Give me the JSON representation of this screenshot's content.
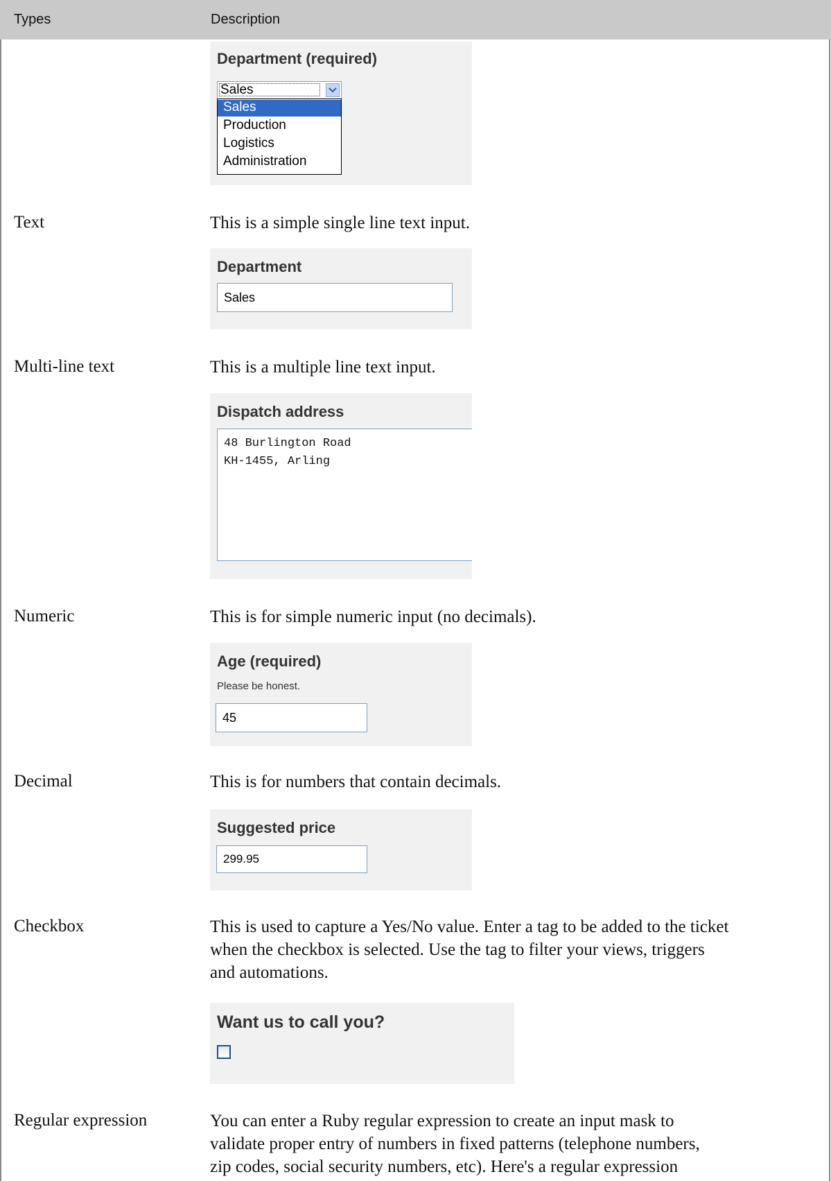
{
  "header": {
    "col_types": "Types",
    "col_description": "Description"
  },
  "rows": {
    "dropdown": {
      "panel": {
        "label": "Department (required)",
        "selected": "Sales",
        "options": [
          "Sales",
          "Production",
          "Logistics",
          "Administration"
        ]
      }
    },
    "text": {
      "type": "Text",
      "desc": "This is a simple single line text input.",
      "panel": {
        "label": "Department",
        "value": "Sales"
      }
    },
    "multiline": {
      "type": "Multi-line text",
      "desc": "This is a multiple line text input.",
      "panel": {
        "label": "Dispatch address",
        "lines": [
          "48 Burlington Road",
          "KH-1455, Arling"
        ]
      }
    },
    "numeric": {
      "type": "Numeric",
      "desc": "This is for simple numeric input (no decimals).",
      "panel": {
        "label": "Age (required)",
        "hint": "Please be honest.",
        "value": "45"
      }
    },
    "decimal": {
      "type": "Decimal",
      "desc": "This is for numbers that contain decimals.",
      "panel": {
        "label": "Suggested price",
        "value": "299.95"
      }
    },
    "checkbox": {
      "type": "Checkbox",
      "desc_lines": [
        "This is used to capture a Yes/No value. Enter a tag to be added to the ticket",
        "when the checkbox is selected. Use the tag to filter your views, triggers",
        "and automations."
      ],
      "panel": {
        "label": "Want us to call you?",
        "checked": false
      }
    },
    "regex": {
      "type": "Regular expression",
      "desc_lines": [
        "You can enter a Ruby regular expression to create an input mask to",
        "validate proper entry of numbers in fixed patterns (telephone numbers,",
        "zip codes, social security numbers, etc). Here's a regular expression"
      ]
    }
  },
  "colors": {
    "header_bg": "#c9c9c9",
    "panel_bg": "#f1f1f1",
    "input_border": "#7f9db9",
    "selected_option_bg": "#316ac5"
  }
}
